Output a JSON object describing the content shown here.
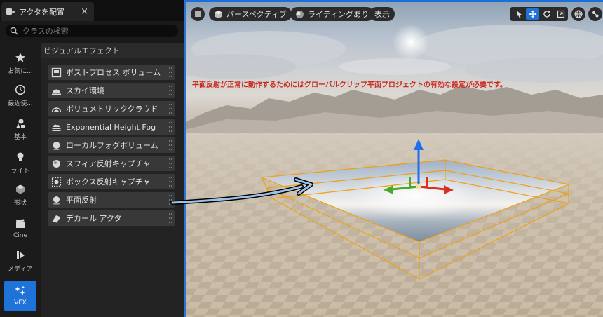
{
  "tab": {
    "title": "アクタを配置",
    "close_glyph": "×"
  },
  "search": {
    "placeholder": "クラスの検索"
  },
  "categories": [
    {
      "label": "お気に...",
      "icon": "star-icon"
    },
    {
      "label": "最近使...",
      "icon": "clock-icon"
    },
    {
      "label": "基本",
      "icon": "basic-shapes-icon"
    },
    {
      "label": "ライト",
      "icon": "lightbulb-icon"
    },
    {
      "label": "形状",
      "icon": "cube-icon"
    },
    {
      "label": "Cine",
      "icon": "clapperboard-icon"
    },
    {
      "label": "メディア",
      "icon": "media-icon"
    },
    {
      "label": "VFX",
      "icon": "sparkles-icon",
      "active": true
    }
  ],
  "list": {
    "header": "ビジュアルエフェクト",
    "items": [
      {
        "label": "ポストプロセス ボリューム",
        "icon": "post-process-icon"
      },
      {
        "label": "スカイ環境",
        "icon": "sky-icon"
      },
      {
        "label": "ボリュメトリッククラウド",
        "icon": "cloud-dome-icon"
      },
      {
        "label": "Exponential Height Fog",
        "icon": "fog-icon"
      },
      {
        "label": "ローカルフォグボリューム",
        "icon": "sphere-icon"
      },
      {
        "label": "スフィア反射キャプチャ",
        "icon": "sphere-capture-icon"
      },
      {
        "label": "ボックス反射キャプチャ",
        "icon": "box-capture-icon"
      },
      {
        "label": "平面反射",
        "icon": "planar-reflection-icon"
      },
      {
        "label": "デカール アクタ",
        "icon": "decal-icon"
      }
    ]
  },
  "viewport": {
    "perspective_label": "パースペクティブ",
    "lighting_label": "ライティングあり",
    "show_label": "表示",
    "warning": "平面反射が正常に動作するためにはグローバルクリップ平面プロジェクトの有効な設定が必要です。"
  },
  "colors": {
    "accent": "#1f72d8",
    "warning": "#cc2a1e",
    "selection": "#f0a010",
    "gizmo_x": "#d8321e",
    "gizmo_y": "#4aa82a",
    "gizmo_z": "#1e6fe8"
  }
}
